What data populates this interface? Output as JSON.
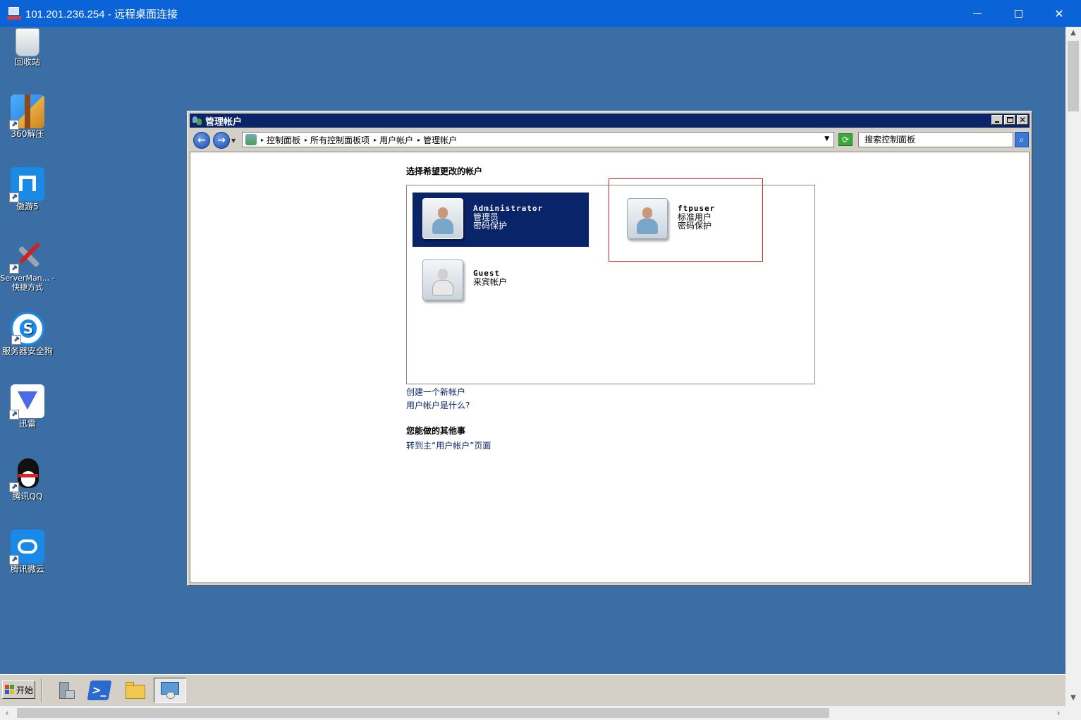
{
  "rdp": {
    "title": "101.201.236.254 - 远程桌面连接"
  },
  "desktop": {
    "icons": [
      {
        "label": "回收站",
        "icon": "recycle-bin-icon"
      },
      {
        "label": "360解压",
        "icon": "archive-icon"
      },
      {
        "label": "傲游5",
        "icon": "maxthon-browser-icon"
      },
      {
        "label": "ServerMan... - 快捷方式",
        "icon": "server-manager-icon"
      },
      {
        "label": "服务器安全狗",
        "icon": "safedog-icon"
      },
      {
        "label": "迅雷",
        "icon": "thunder-icon"
      },
      {
        "label": "腾讯QQ",
        "icon": "qq-penguin-icon"
      },
      {
        "label": "腾讯微云",
        "icon": "weiyun-cloud-icon"
      }
    ]
  },
  "window": {
    "title": "管理帐户",
    "breadcrumbs": [
      "控制面板",
      "所有控制面板项",
      "用户帐户",
      "管理帐户"
    ],
    "search_placeholder": "搜索控制面板"
  },
  "content": {
    "heading": "选择希望更改的帐户",
    "accounts": [
      {
        "name": "Administrator",
        "type": "管理员",
        "status": "密码保护",
        "selected": true
      },
      {
        "name": "ftpuser",
        "type": "标准用户",
        "status": "密码保护",
        "selected": false
      },
      {
        "name": "Guest",
        "type": "来宾帐户",
        "status": "",
        "selected": false
      }
    ],
    "links": {
      "create": "创建一个新帐户",
      "what_is": "用户帐户是什么?"
    },
    "other_heading": "您能做的其他事",
    "other_link": "转到主“用户帐户”页面"
  },
  "taskbar": {
    "start_label": "开始",
    "items": [
      "server-manager-icon",
      "powershell-icon",
      "explorer-folder-icon",
      "control-panel-icon"
    ]
  },
  "colors": {
    "desktop_bg": "#3a6ea5",
    "title_active": "#0a246a",
    "rdp_title": "#0a64d8",
    "highlight": "#e02020"
  }
}
